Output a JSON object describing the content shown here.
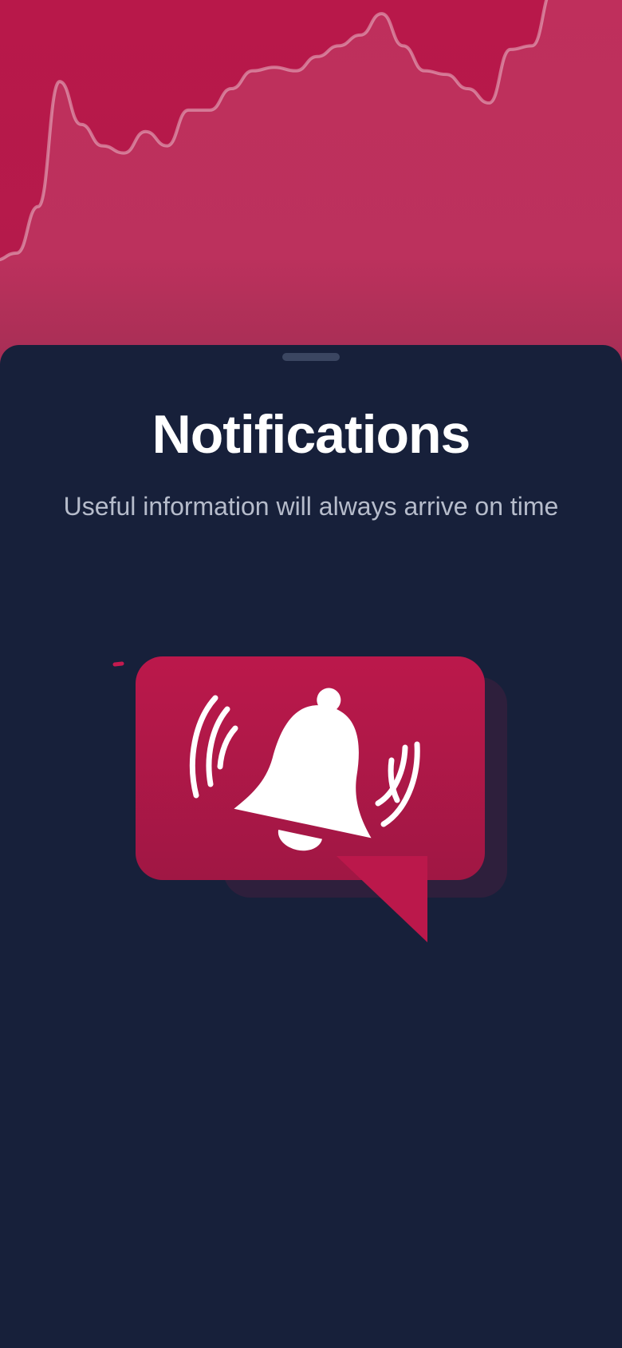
{
  "screen": {
    "title": "Notifications",
    "subtitle": "Useful information will always arrive on time"
  },
  "illustration": {
    "icon": "bell-ringing-icon",
    "bubble_color": "#b8184a",
    "shadow_color": "#2e1f3c"
  },
  "colors": {
    "accent": "#b8184a",
    "background": "#17203a",
    "title_text": "#ffffff",
    "subtitle_text": "#b6bccb"
  },
  "hero_chart": {
    "type": "area",
    "series": [
      30,
      32,
      45,
      80,
      68,
      62,
      60,
      66,
      62,
      72,
      72,
      78,
      83,
      84,
      83,
      87,
      90,
      93,
      99,
      90,
      83,
      82,
      78,
      74,
      89,
      90,
      106
    ]
  }
}
